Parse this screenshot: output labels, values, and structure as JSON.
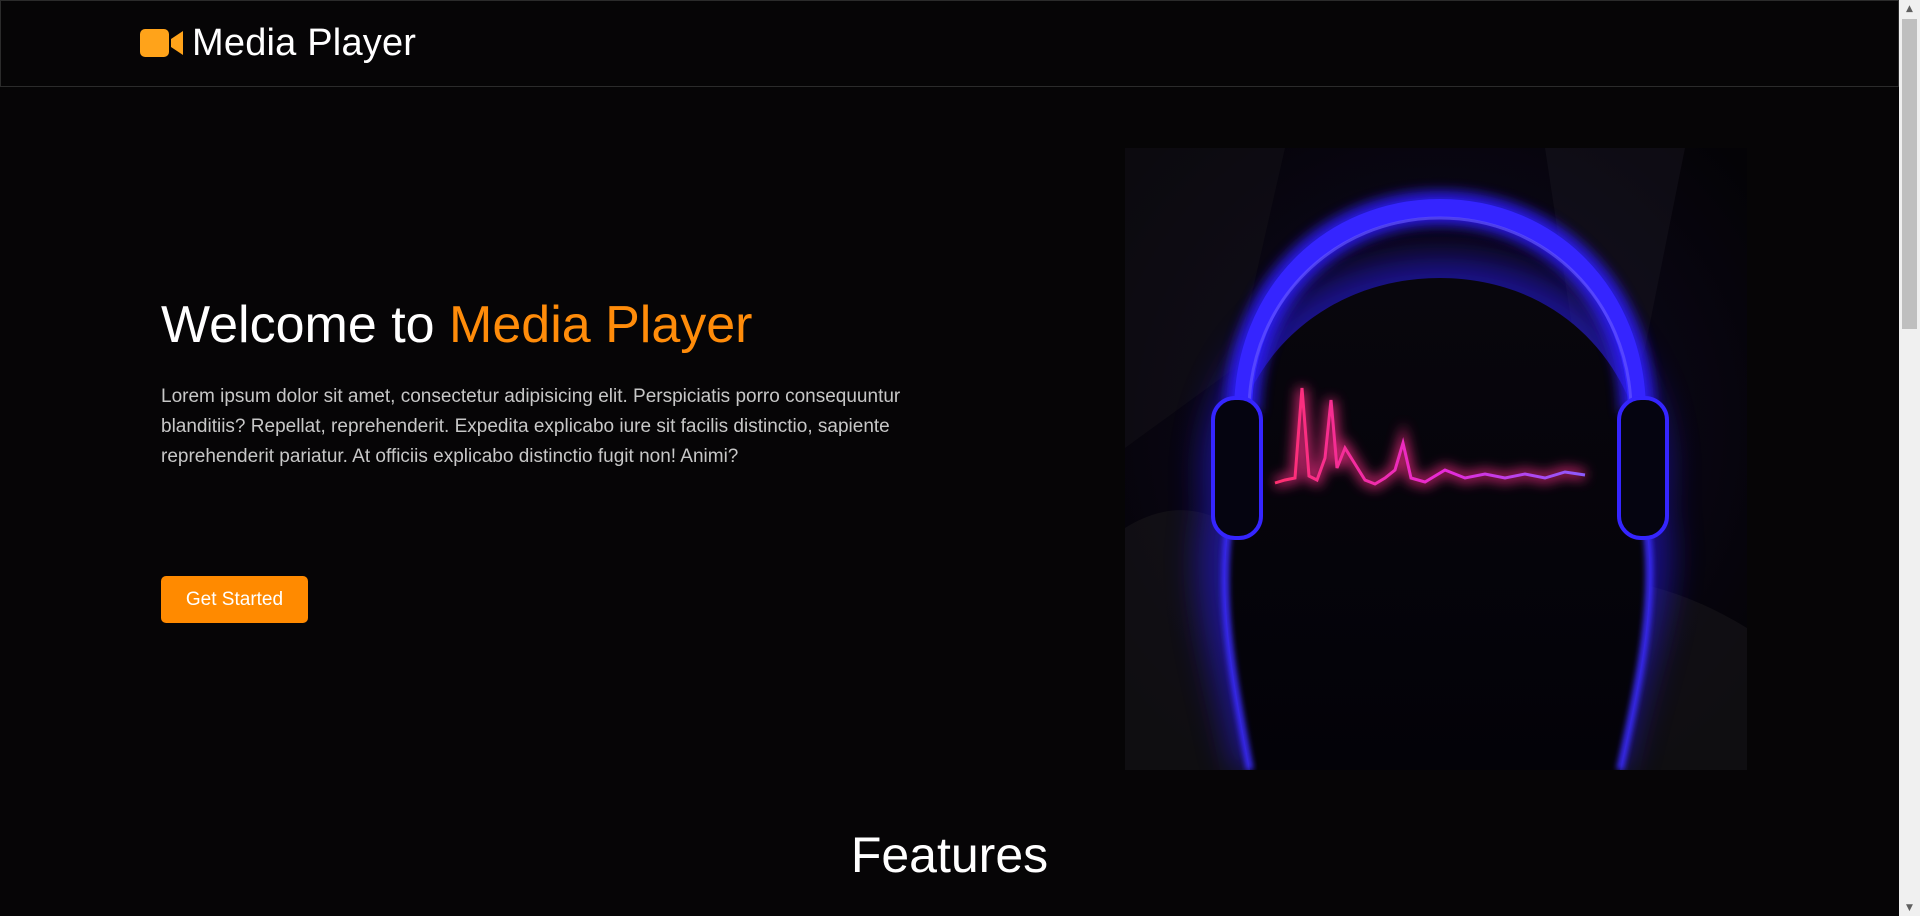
{
  "navbar": {
    "brand": "Media Player",
    "brand_icon": "video-camera-icon",
    "brand_color": "#ffa31a"
  },
  "hero": {
    "title_prefix": "Welcome to ",
    "title_accent": "Media Player",
    "description": "Lorem ipsum dolor sit amet, consectetur adipisicing elit. Perspiciatis porro consequuntur blanditiis? Repellat, reprehenderit. Expedita explicabo iure sit facilis distinctio, sapiente reprehenderit pariatur. At officiis explicabo distinctio fugit non! Animi?",
    "cta_label": "Get Started",
    "image_subject": "headphones-waveform-illustration"
  },
  "features": {
    "title": "Features"
  },
  "colors": {
    "accent": "#ff8c0a",
    "background": "#060506",
    "text_muted": "#c7c7c7"
  }
}
